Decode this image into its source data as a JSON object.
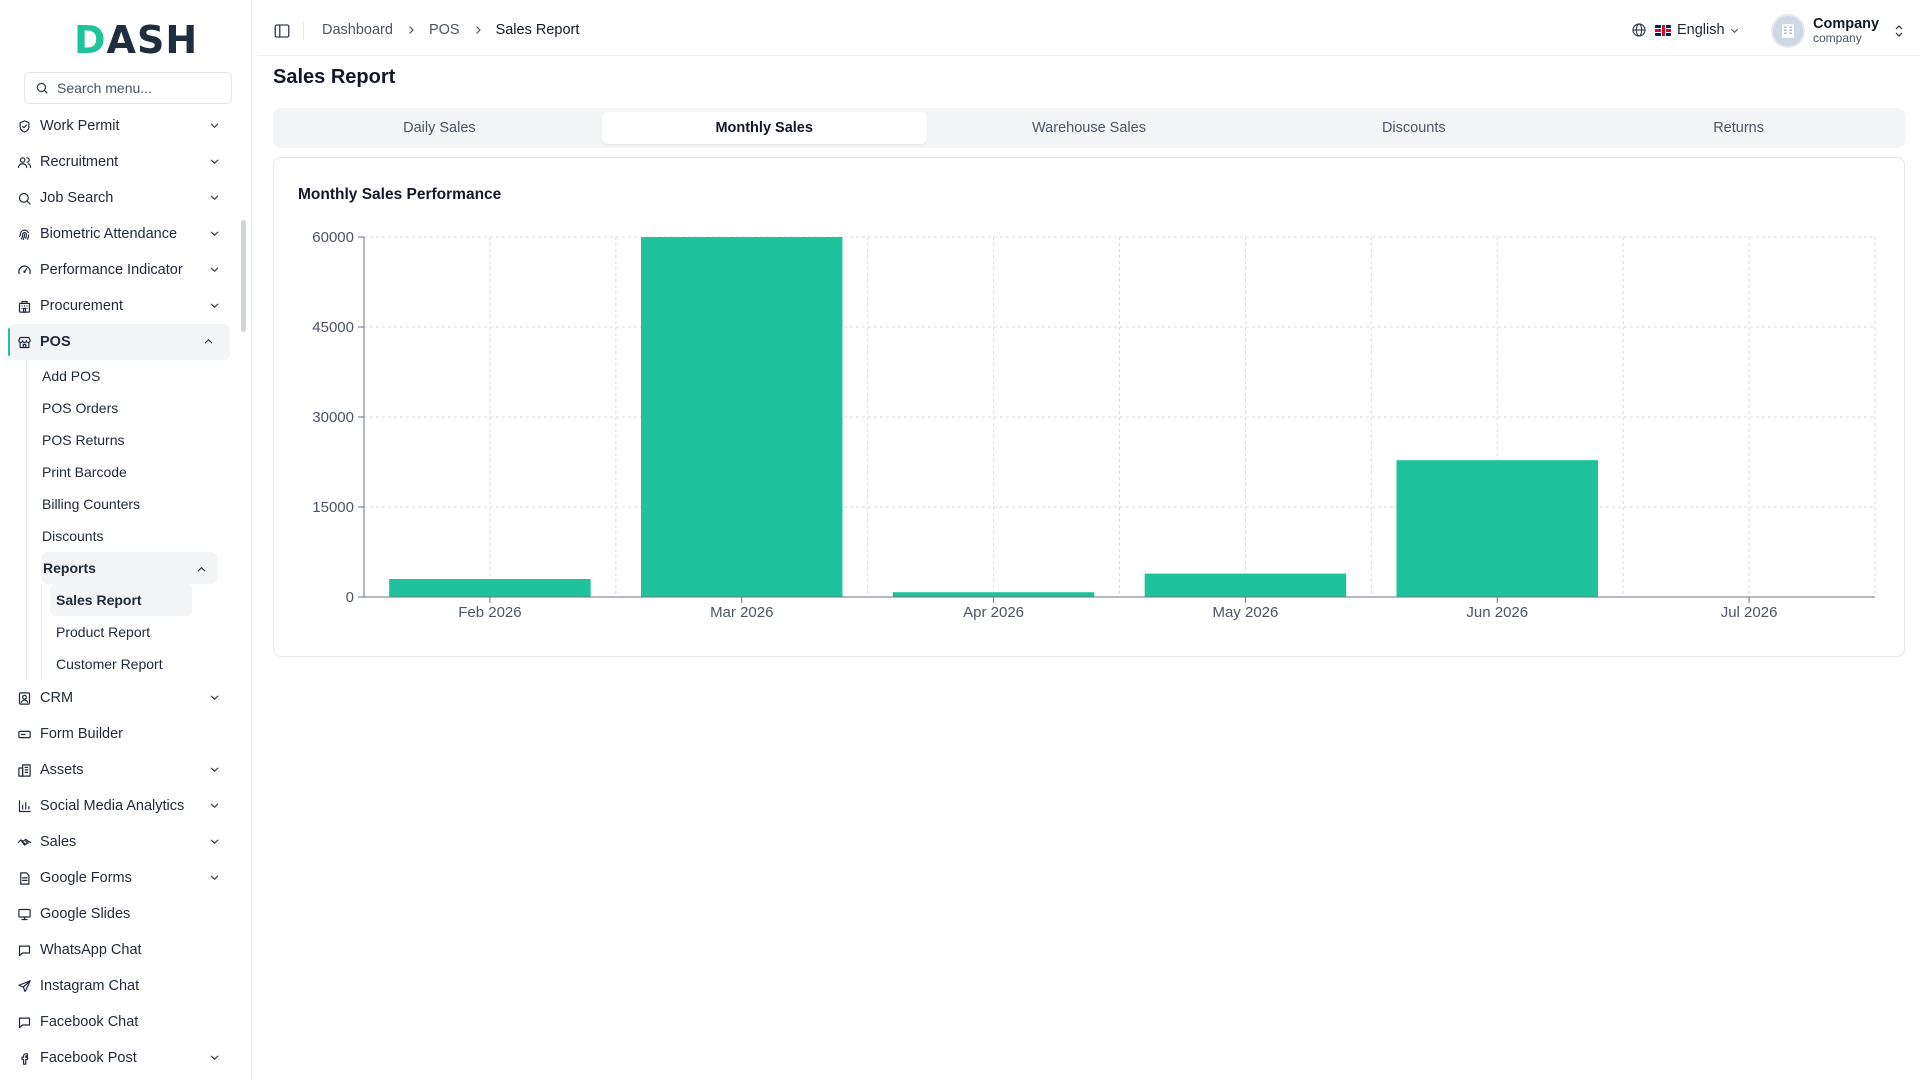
{
  "brand": {
    "logo_text_a": "D",
    "logo_text_b": "ASH",
    "accent_color": "#1ec39c"
  },
  "search": {
    "placeholder": "Search menu..."
  },
  "sidebar": {
    "items_top": [
      {
        "label": "Work Permit",
        "icon": "shield-icon"
      },
      {
        "label": "Recruitment",
        "icon": "users-icon"
      },
      {
        "label": "Job Search",
        "icon": "search-icon"
      },
      {
        "label": "Biometric Attendance",
        "icon": "fingerprint-icon"
      },
      {
        "label": "Performance Indicator",
        "icon": "gauge-icon"
      },
      {
        "label": "Procurement",
        "icon": "building-icon"
      }
    ],
    "pos": {
      "label": "POS",
      "icon": "store-icon"
    },
    "pos_children": [
      "Add POS",
      "POS Orders",
      "POS Returns",
      "Print Barcode",
      "Billing Counters",
      "Discounts"
    ],
    "reports": {
      "label": "Reports"
    },
    "reports_children": [
      "Sales Report",
      "Product Report",
      "Customer Report"
    ],
    "items_bottom": [
      {
        "label": "CRM",
        "icon": "contact-icon",
        "chevron": true
      },
      {
        "label": "Form Builder",
        "icon": "form-icon",
        "chevron": false
      },
      {
        "label": "Assets",
        "icon": "assets-icon",
        "chevron": true
      },
      {
        "label": "Social Media Analytics",
        "icon": "bar-chart-icon",
        "chevron": true
      },
      {
        "label": "Sales",
        "icon": "handshake-icon",
        "chevron": true
      },
      {
        "label": "Google Forms",
        "icon": "document-icon",
        "chevron": true
      },
      {
        "label": "Google Slides",
        "icon": "presentation-icon",
        "chevron": false
      },
      {
        "label": "WhatsApp Chat",
        "icon": "chat-icon",
        "chevron": false
      },
      {
        "label": "Instagram Chat",
        "icon": "send-icon",
        "chevron": false
      },
      {
        "label": "Facebook Chat",
        "icon": "chat-icon",
        "chevron": false
      },
      {
        "label": "Facebook Post",
        "icon": "facebook-icon",
        "chevron": true
      }
    ]
  },
  "breadcrumb": {
    "items": [
      "Dashboard",
      "POS"
    ],
    "current": "Sales Report"
  },
  "header": {
    "language": "English",
    "user_name": "Company",
    "user_role": "company"
  },
  "page": {
    "title": "Sales Report"
  },
  "tabs": [
    {
      "label": "Daily Sales",
      "active": false
    },
    {
      "label": "Monthly Sales",
      "active": true
    },
    {
      "label": "Warehouse Sales",
      "active": false
    },
    {
      "label": "Discounts",
      "active": false
    },
    {
      "label": "Returns",
      "active": false
    }
  ],
  "card": {
    "title": "Monthly Sales Performance"
  },
  "chart_data": {
    "type": "bar",
    "categories": [
      "Feb 2026",
      "Mar 2026",
      "Apr 2026",
      "May 2026",
      "Jun 2026",
      "Jul 2026"
    ],
    "values": [
      3000,
      60000,
      800,
      3900,
      22800,
      0
    ],
    "ylim": [
      0,
      60000
    ],
    "yticks": [
      0,
      15000,
      30000,
      45000,
      60000
    ],
    "grid": true,
    "bar_color": "#1ec39c"
  }
}
